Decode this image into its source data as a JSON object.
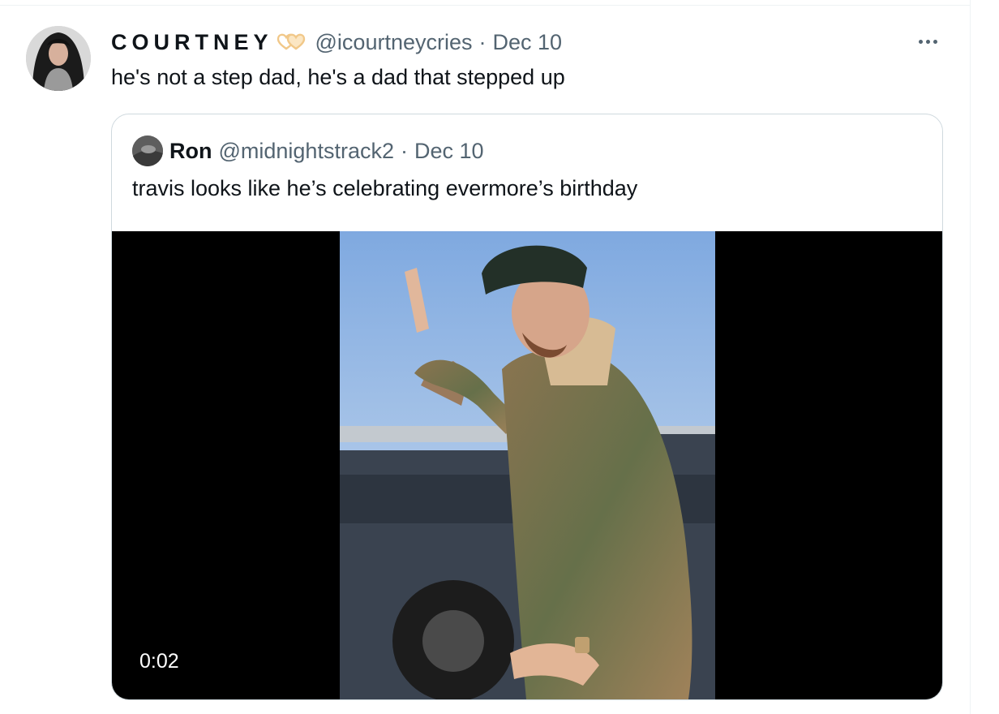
{
  "tweet": {
    "author": {
      "display_name": "COURTNEY",
      "handle": "@icourtneycries",
      "name_emoji": "heart-hands-icon"
    },
    "separator": "·",
    "date": "Dec 10",
    "text": "he's not a step dad, he's a dad that stepped up",
    "more_icon": "ellipsis-icon"
  },
  "quote": {
    "author": {
      "display_name": "Ron",
      "handle": "@midnightstrack2"
    },
    "separator": "·",
    "date": "Dec 10",
    "text": "travis looks like he’s celebrating evermore’s birthday",
    "video": {
      "duration": "0:02"
    }
  },
  "colors": {
    "text_primary": "#0f1419",
    "text_secondary": "#536471",
    "border": "#cfd9de",
    "video_background": "#000000"
  }
}
